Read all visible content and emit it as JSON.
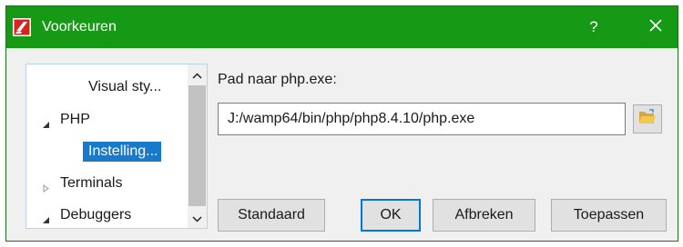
{
  "window": {
    "title": "Voorkeuren",
    "help_label": "?",
    "accent_color": "#169a16"
  },
  "tree": {
    "items": [
      {
        "label": "Visual sty...",
        "expander": "none"
      },
      {
        "label": "PHP",
        "expander": "expanded"
      },
      {
        "label": "Instelling...",
        "expander": "none",
        "selected": true
      },
      {
        "label": "Terminals",
        "expander": "collapsed"
      },
      {
        "label": "Debuggers",
        "expander": "expanded"
      }
    ]
  },
  "settings": {
    "path_label": "Pad naar php.exe:",
    "path_value": "J:/wamp64/bin/php/php8.4.10/php.exe",
    "browse_icon": "folder-open-icon"
  },
  "buttons": {
    "standaard": "Standaard",
    "ok": "OK",
    "afbreken": "Afbreken",
    "toepassen": "Toepassen"
  }
}
